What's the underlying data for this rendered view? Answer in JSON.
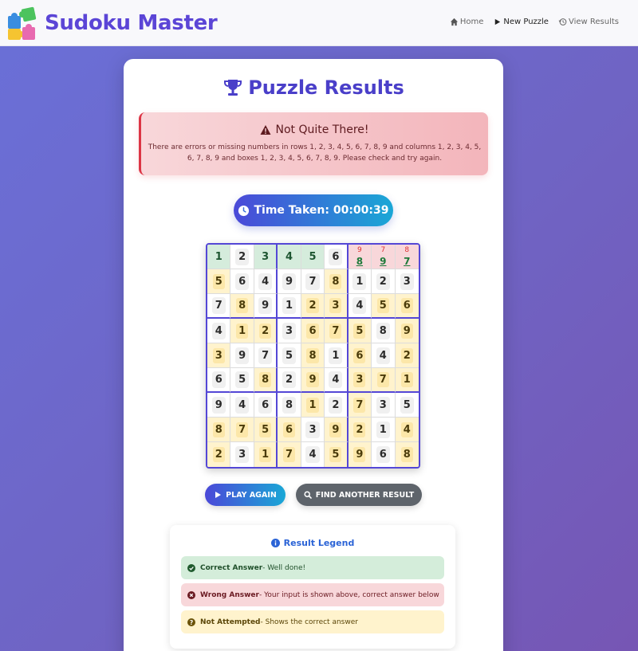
{
  "navbar": {
    "brand": "Sudoku Master",
    "links": [
      {
        "label": "Home",
        "icon": "home-icon"
      },
      {
        "label": "New Puzzle",
        "icon": "play-icon"
      },
      {
        "label": "View Results",
        "icon": "history-icon"
      }
    ]
  },
  "results": {
    "title": "Puzzle Results",
    "alert_title": "Not Quite There!",
    "alert_message": "There are errors or missing numbers in rows 1, 2, 3, 4, 5, 6, 7, 8, 9 and columns 1, 2, 3, 4, 5, 6, 7, 8, 9 and boxes 1, 2, 3, 4, 5, 6, 7, 8, 9. Please check and try again.",
    "time_taken": "Time Taken: 00:00:39"
  },
  "grid": {
    "rows": [
      [
        {
          "v": "1",
          "s": "correct"
        },
        {
          "v": "2",
          "s": "given"
        },
        {
          "v": "3",
          "s": "correct"
        },
        {
          "v": "4",
          "s": "correct"
        },
        {
          "v": "5",
          "s": "correct"
        },
        {
          "v": "6",
          "s": "given"
        },
        {
          "u": "9",
          "v": "8",
          "s": "wrong"
        },
        {
          "u": "7",
          "v": "9",
          "s": "wrong"
        },
        {
          "u": "8",
          "v": "7",
          "s": "wrong"
        }
      ],
      [
        {
          "v": "5",
          "s": "notatt"
        },
        {
          "v": "6",
          "s": "given"
        },
        {
          "v": "4",
          "s": "given"
        },
        {
          "v": "9",
          "s": "given"
        },
        {
          "v": "7",
          "s": "given"
        },
        {
          "v": "8",
          "s": "notatt"
        },
        {
          "v": "1",
          "s": "given"
        },
        {
          "v": "2",
          "s": "given"
        },
        {
          "v": "3",
          "s": "given"
        }
      ],
      [
        {
          "v": "7",
          "s": "given"
        },
        {
          "v": "8",
          "s": "notatt"
        },
        {
          "v": "9",
          "s": "given"
        },
        {
          "v": "1",
          "s": "given"
        },
        {
          "v": "2",
          "s": "notatt"
        },
        {
          "v": "3",
          "s": "notatt"
        },
        {
          "v": "4",
          "s": "given"
        },
        {
          "v": "5",
          "s": "notatt"
        },
        {
          "v": "6",
          "s": "notatt"
        }
      ],
      [
        {
          "v": "4",
          "s": "given"
        },
        {
          "v": "1",
          "s": "notatt"
        },
        {
          "v": "2",
          "s": "notatt"
        },
        {
          "v": "3",
          "s": "given"
        },
        {
          "v": "6",
          "s": "notatt"
        },
        {
          "v": "7",
          "s": "notatt"
        },
        {
          "v": "5",
          "s": "notatt"
        },
        {
          "v": "8",
          "s": "given"
        },
        {
          "v": "9",
          "s": "notatt"
        }
      ],
      [
        {
          "v": "3",
          "s": "notatt"
        },
        {
          "v": "9",
          "s": "given"
        },
        {
          "v": "7",
          "s": "given"
        },
        {
          "v": "5",
          "s": "given"
        },
        {
          "v": "8",
          "s": "notatt"
        },
        {
          "v": "1",
          "s": "given"
        },
        {
          "v": "6",
          "s": "notatt"
        },
        {
          "v": "4",
          "s": "given"
        },
        {
          "v": "2",
          "s": "notatt"
        }
      ],
      [
        {
          "v": "6",
          "s": "given"
        },
        {
          "v": "5",
          "s": "given"
        },
        {
          "v": "8",
          "s": "notatt"
        },
        {
          "v": "2",
          "s": "given"
        },
        {
          "v": "9",
          "s": "notatt"
        },
        {
          "v": "4",
          "s": "given"
        },
        {
          "v": "3",
          "s": "notatt"
        },
        {
          "v": "7",
          "s": "notatt"
        },
        {
          "v": "1",
          "s": "notatt"
        }
      ],
      [
        {
          "v": "9",
          "s": "given"
        },
        {
          "v": "4",
          "s": "given"
        },
        {
          "v": "6",
          "s": "given"
        },
        {
          "v": "8",
          "s": "given"
        },
        {
          "v": "1",
          "s": "notatt"
        },
        {
          "v": "2",
          "s": "given"
        },
        {
          "v": "7",
          "s": "notatt"
        },
        {
          "v": "3",
          "s": "given"
        },
        {
          "v": "5",
          "s": "given"
        }
      ],
      [
        {
          "v": "8",
          "s": "notatt"
        },
        {
          "v": "7",
          "s": "notatt"
        },
        {
          "v": "5",
          "s": "notatt"
        },
        {
          "v": "6",
          "s": "notatt"
        },
        {
          "v": "3",
          "s": "given"
        },
        {
          "v": "9",
          "s": "notatt"
        },
        {
          "v": "2",
          "s": "notatt"
        },
        {
          "v": "1",
          "s": "given"
        },
        {
          "v": "4",
          "s": "notatt"
        }
      ],
      [
        {
          "v": "2",
          "s": "notatt"
        },
        {
          "v": "3",
          "s": "given"
        },
        {
          "v": "1",
          "s": "notatt"
        },
        {
          "v": "7",
          "s": "notatt"
        },
        {
          "v": "4",
          "s": "given"
        },
        {
          "v": "5",
          "s": "notatt"
        },
        {
          "v": "9",
          "s": "notatt"
        },
        {
          "v": "6",
          "s": "given"
        },
        {
          "v": "8",
          "s": "notatt"
        }
      ]
    ]
  },
  "actions": {
    "play_again": "PLAY AGAIN",
    "find_another": "FIND ANOTHER RESULT"
  },
  "legend": {
    "title": "Result Legend",
    "correct_label": "Correct Answer",
    "correct_desc": "- Well done!",
    "wrong_label": "Wrong Answer",
    "wrong_desc": "- Your input is shown above, correct answer below",
    "na_label": "Not Attempted",
    "na_desc": "- Shows the correct answer"
  },
  "colors": {
    "brand": "#5b45d6",
    "correct": "#d4edda",
    "wrong": "#f8d7da",
    "not_attempted": "#fff3cd"
  }
}
